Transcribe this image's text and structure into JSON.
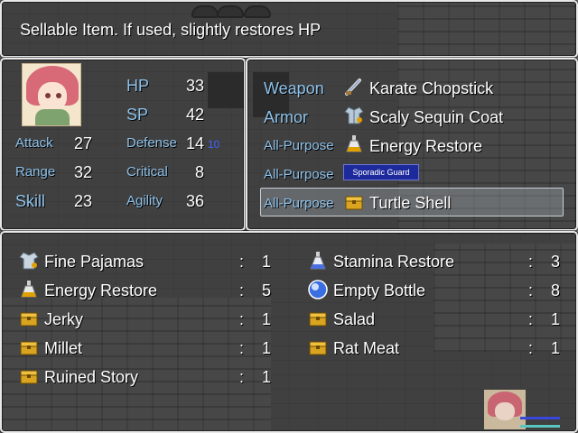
{
  "help": {
    "text": "Sellable Item. If used, slightly restores HP"
  },
  "status": {
    "hp_label": "HP",
    "hp_value": "33",
    "sp_label": "SP",
    "sp_value": "42",
    "attack_label": "Attack",
    "attack_value": "27",
    "range_label": "Range",
    "range_value": "32",
    "skill_label": "Skill",
    "skill_value": "23",
    "defense_label": "Defense",
    "defense_value": "14",
    "defense_bonus": "10",
    "critical_label": "Critical",
    "critical_value": "8",
    "agility_label": "Agility",
    "agility_value": "36"
  },
  "equip": {
    "slots": [
      {
        "slot": "Weapon",
        "item": "Karate Chopstick",
        "icon": "chopstick-icon"
      },
      {
        "slot": "Armor",
        "item": "Scaly Sequin Coat",
        "icon": "coat-icon"
      },
      {
        "slot": "All-Purpose",
        "item": "Energy Restore",
        "icon": "potion-icon"
      },
      {
        "slot": "All-Purpose",
        "item": "",
        "tag": "Sporadic Guard",
        "icon": ""
      },
      {
        "slot": "All-Purpose",
        "item": "Turtle Shell",
        "icon": "chest-icon"
      }
    ]
  },
  "inventory": {
    "separator": ":",
    "items": [
      {
        "name": "Fine Pajamas",
        "count": "1",
        "icon": "pajamas-icon"
      },
      {
        "name": "Energy Restore",
        "count": "5",
        "icon": "potion-icon"
      },
      {
        "name": "Jerky",
        "count": "1",
        "icon": "chest-icon"
      },
      {
        "name": "Millet",
        "count": "1",
        "icon": "chest-icon"
      },
      {
        "name": "Ruined Story",
        "count": "1",
        "icon": "chest-icon"
      },
      {
        "name": "Stamina Restore",
        "count": "3",
        "icon": "flask-icon"
      },
      {
        "name": "Empty Bottle",
        "count": "8",
        "icon": "orb-icon"
      },
      {
        "name": "Salad",
        "count": "1",
        "icon": "chest-icon"
      },
      {
        "name": "Rat Meat",
        "count": "1",
        "icon": "chest-icon"
      }
    ]
  },
  "colors": {
    "system_blue": "#8ec2ea",
    "bonus_blue": "#3f63ff",
    "hp_bar": "#3a46d8",
    "sp_bar": "#58c7c0",
    "tag_bg": "#1d2a9b"
  }
}
